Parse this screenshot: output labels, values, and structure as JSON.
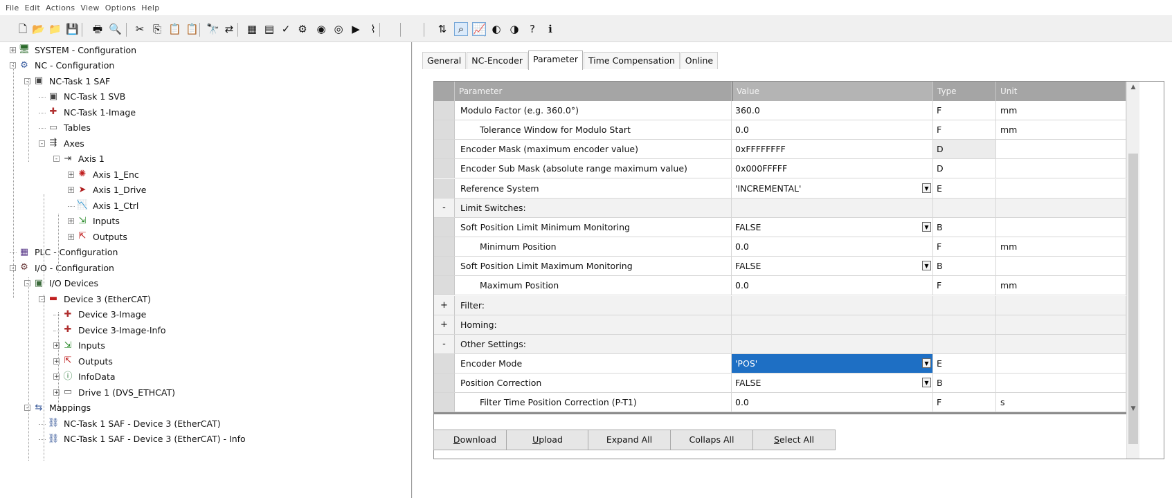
{
  "menu": [
    "File",
    "Edit",
    "Actions",
    "View",
    "Options",
    "Help"
  ],
  "toolbar_icons": [
    "new-file",
    "open-folder",
    "open-project",
    "save",
    "print",
    "print-preview",
    "cut",
    "copy",
    "paste",
    "paste-special",
    "find",
    "replace",
    "grid",
    "list-view",
    "checkmark",
    "activate",
    "target",
    "target-alt",
    "run",
    "graph",
    "toggle",
    "scope",
    "chart",
    "show",
    "show-sub",
    "help",
    "about"
  ],
  "tree": [
    {
      "label": "SYSTEM - Configuration",
      "icon": "system-icon",
      "exp": "+"
    },
    {
      "label": "NC - Configuration",
      "icon": "nc-icon",
      "exp": "-"
    },
    {
      "label": "NC-Task 1 SAF",
      "icon": "task-icon",
      "exp": "-"
    },
    {
      "label": "NC-Task 1 SVB",
      "icon": "task-icon",
      "exp": ""
    },
    {
      "label": "NC-Task 1-Image",
      "icon": "image-icon",
      "exp": ""
    },
    {
      "label": "Tables",
      "icon": "table-icon",
      "exp": ""
    },
    {
      "label": "Axes",
      "icon": "axes-icon",
      "exp": "-"
    },
    {
      "label": "Axis 1",
      "icon": "axis-icon",
      "exp": "-"
    },
    {
      "label": "Axis 1_Enc",
      "icon": "encoder-icon",
      "exp": "+"
    },
    {
      "label": "Axis 1_Drive",
      "icon": "drive-icon",
      "exp": "+"
    },
    {
      "label": "Axis 1_Ctrl",
      "icon": "controller-icon",
      "exp": ""
    },
    {
      "label": "Inputs",
      "icon": "inputs-icon",
      "exp": "+"
    },
    {
      "label": "Outputs",
      "icon": "outputs-icon",
      "exp": "+"
    },
    {
      "label": "PLC - Configuration",
      "icon": "plc-icon",
      "exp": ""
    },
    {
      "label": "I/O - Configuration",
      "icon": "io-icon",
      "exp": "-"
    },
    {
      "label": "I/O Devices",
      "icon": "io-devices-icon",
      "exp": "-"
    },
    {
      "label": "Device 3 (EtherCAT)",
      "icon": "ethercat-icon",
      "exp": "-"
    },
    {
      "label": "Device 3-Image",
      "icon": "image-icon",
      "exp": ""
    },
    {
      "label": "Device 3-Image-Info",
      "icon": "image-icon",
      "exp": ""
    },
    {
      "label": "Inputs",
      "icon": "inputs-icon",
      "exp": "+"
    },
    {
      "label": "Outputs",
      "icon": "outputs-icon",
      "exp": "+"
    },
    {
      "label": "InfoData",
      "icon": "infodata-icon",
      "exp": "+"
    },
    {
      "label": "Drive 1 (DVS_ETHCAT)",
      "icon": "drive-box-icon",
      "exp": "+"
    },
    {
      "label": "Mappings",
      "icon": "mappings-icon",
      "exp": "-"
    },
    {
      "label": "NC-Task 1 SAF - Device 3 (EtherCAT)",
      "icon": "mapping-link-icon",
      "exp": ""
    },
    {
      "label": "NC-Task 1 SAF - Device 3 (EtherCAT) - Info",
      "icon": "mapping-link-icon",
      "exp": ""
    }
  ],
  "tabs": [
    {
      "label": "General",
      "active": false
    },
    {
      "label": "NC-Encoder",
      "active": false
    },
    {
      "label": "Parameter",
      "active": true
    },
    {
      "label": "Time Compensation",
      "active": false
    },
    {
      "label": "Online",
      "active": false
    }
  ],
  "grid": {
    "headers": {
      "parameter": "Parameter",
      "value": "Value",
      "type": "Type",
      "unit": "Unit"
    },
    "rows": [
      {
        "sign": "",
        "param": "Modulo Factor (e.g. 360.0°)",
        "value": "360.0",
        "type": "F",
        "unit": "mm",
        "indent": false,
        "group": false,
        "dropdown": false
      },
      {
        "sign": "",
        "param": "Tolerance Window for Modulo Start",
        "value": "0.0",
        "type": "F",
        "unit": "mm",
        "indent": true,
        "group": false,
        "dropdown": false
      },
      {
        "sign": "",
        "param": "Encoder Mask (maximum encoder value)",
        "value": "0xFFFFFFFF",
        "type": "D",
        "unit": "",
        "indent": false,
        "group": false,
        "dropdown": false
      },
      {
        "sign": "",
        "param": "Encoder Sub Mask (absolute range maximum value)",
        "value": "0x000FFFFF",
        "type": "D",
        "unit": "",
        "indent": false,
        "group": false,
        "dropdown": false
      },
      {
        "sign": "",
        "param": "Reference System",
        "value": "'INCREMENTAL'",
        "type": "E",
        "unit": "",
        "indent": false,
        "group": false,
        "dropdown": true
      },
      {
        "sign": "-",
        "param": "Limit Switches:",
        "value": "",
        "type": "",
        "unit": "",
        "indent": false,
        "group": true,
        "dropdown": false
      },
      {
        "sign": "",
        "param": "Soft Position Limit Minimum Monitoring",
        "value": "FALSE",
        "type": "B",
        "unit": "",
        "indent": false,
        "group": false,
        "dropdown": true
      },
      {
        "sign": "",
        "param": "Minimum Position",
        "value": "0.0",
        "type": "F",
        "unit": "mm",
        "indent": true,
        "group": false,
        "dropdown": false
      },
      {
        "sign": "",
        "param": "Soft Position Limit Maximum Monitoring",
        "value": "FALSE",
        "type": "B",
        "unit": "",
        "indent": false,
        "group": false,
        "dropdown": true
      },
      {
        "sign": "",
        "param": "Maximum Position",
        "value": "0.0",
        "type": "F",
        "unit": "mm",
        "indent": true,
        "group": false,
        "dropdown": false
      },
      {
        "sign": "+",
        "param": "Filter:",
        "value": "",
        "type": "",
        "unit": "",
        "indent": false,
        "group": true,
        "dropdown": false
      },
      {
        "sign": "+",
        "param": "Homing:",
        "value": "",
        "type": "",
        "unit": "",
        "indent": false,
        "group": true,
        "dropdown": false
      },
      {
        "sign": "-",
        "param": "Other Settings:",
        "value": "",
        "type": "",
        "unit": "",
        "indent": false,
        "group": true,
        "dropdown": false
      },
      {
        "sign": "",
        "param": "Encoder Mode",
        "value": "'POS'",
        "type": "E",
        "unit": "",
        "indent": false,
        "group": false,
        "dropdown": true,
        "selected": true
      },
      {
        "sign": "",
        "param": "Position Correction",
        "value": "FALSE",
        "type": "B",
        "unit": "",
        "indent": false,
        "group": false,
        "dropdown": true
      },
      {
        "sign": "",
        "param": "Filter Time Position Correction (P-T1)",
        "value": "0.0",
        "type": "F",
        "unit": "s",
        "indent": true,
        "group": false,
        "dropdown": false
      }
    ]
  },
  "buttons": [
    {
      "label": "Download",
      "name": "download-button",
      "u": "D",
      "rest": "ownload"
    },
    {
      "label": "Upload",
      "name": "upload-button",
      "u": "U",
      "rest": "pload"
    },
    {
      "label": "Expand All",
      "name": "expand-all-button",
      "u": "",
      "rest": "Expand All"
    },
    {
      "label": "Collaps All",
      "name": "collaps-all-button",
      "u": "",
      "rest": "Collaps All"
    },
    {
      "label": "Select All",
      "name": "select-all-button",
      "u": "S",
      "rest": "elect All"
    }
  ]
}
